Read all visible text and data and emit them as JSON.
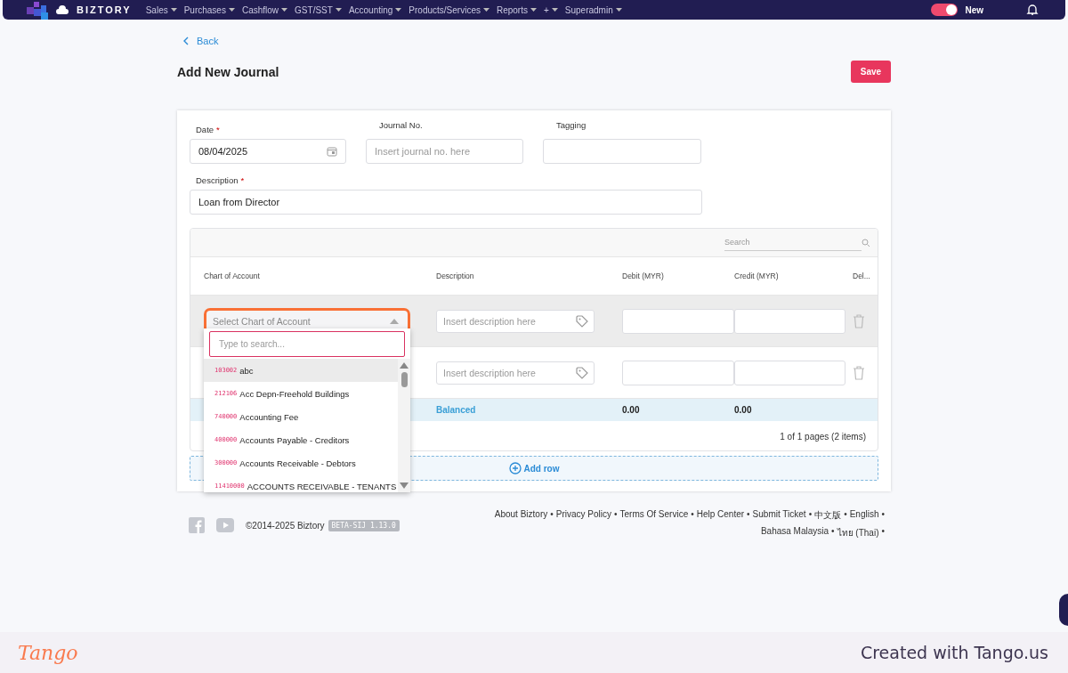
{
  "nav": {
    "brand": "BIZTORY",
    "menu": [
      "Sales",
      "Purchases",
      "Cashflow",
      "GST/SST",
      "Accounting",
      "Products/Services",
      "Reports",
      "+",
      "Superadmin"
    ],
    "toggle": {
      "on": true,
      "label": "New"
    }
  },
  "back": "Back",
  "title": "Add New Journal",
  "save": "Save",
  "form": {
    "date": {
      "label": "Date",
      "required": "*",
      "value": "08/04/2025"
    },
    "journal_no": {
      "label": "Journal No.",
      "placeholder": "Insert journal no. here"
    },
    "tagging": {
      "label": "Tagging"
    },
    "description": {
      "label": "Description",
      "required": "*",
      "value": "Loan from Director"
    }
  },
  "table": {
    "search_placeholder": "Search",
    "columns": [
      "Chart of Account",
      "Description",
      "Debit (MYR)",
      "Credit (MYR)",
      "Del..."
    ],
    "rows": [
      {
        "account_placeholder": "Select Chart of Account",
        "description_placeholder": "Insert description here",
        "highlighted": true
      },
      {
        "description_placeholder": "Insert description here",
        "highlighted": false
      }
    ],
    "totals": {
      "status": "Balanced",
      "debit": "0.00",
      "credit": "0.00"
    },
    "pagination": "1 of 1 pages (2 items)",
    "add_row": "Add row"
  },
  "dropdown": {
    "search_placeholder": "Type to search...",
    "items": [
      {
        "code": "103002",
        "name": "abc",
        "selected": true
      },
      {
        "code": "212106",
        "name": "Acc Depn-Freehold Buildings",
        "selected": false
      },
      {
        "code": "740000",
        "name": "Accounting Fee",
        "selected": false
      },
      {
        "code": "400000",
        "name": "Accounts Payable - Creditors",
        "selected": false
      },
      {
        "code": "300000",
        "name": "Accounts Receivable - Debtors",
        "selected": false
      },
      {
        "code": "11410000",
        "name": "ACCOUNTS RECEIVABLE - TENANTS",
        "selected": false
      }
    ]
  },
  "footer": {
    "copyright": "©2014-2025 Biztory",
    "version": "BETA-SIJ 1.13.0",
    "separator": "•",
    "links": [
      "About Biztory",
      "Privacy Policy",
      "Terms Of Service",
      "Help Center",
      "Submit Ticket",
      "中文版",
      "English",
      "Bahasa Malaysia",
      "ไทย (Thai)"
    ]
  },
  "tango": {
    "logo": "Tango",
    "credit": "Created with Tango.us"
  }
}
